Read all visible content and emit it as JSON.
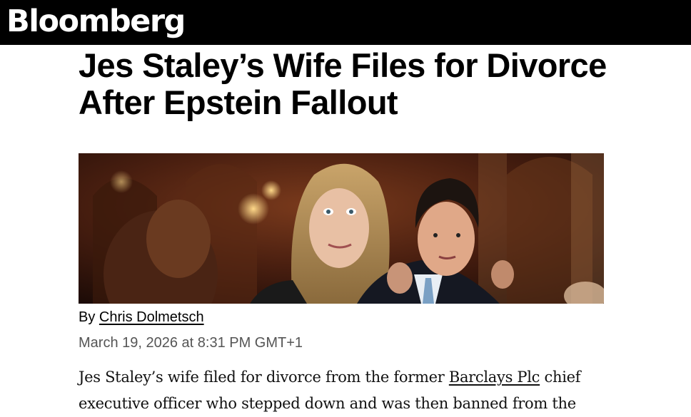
{
  "header": {
    "logo_text": "Bloomberg",
    "background": "#000000"
  },
  "article": {
    "headline": "Jes Staley’s Wife Files for Divorce After Epstein Fallout",
    "photo": {
      "description_icon": "article-photo"
    },
    "byline": {
      "prefix": "By ",
      "author": "Chris Dolmetsch"
    },
    "date": "March 19, 2026 at 8:31 PM GMT+1",
    "body": {
      "part1": "Jes Staley’s wife filed for divorce from the former ",
      "link": "Barclays Plc",
      "part2": " chief executive officer who stepped down and was then banned from the"
    }
  }
}
